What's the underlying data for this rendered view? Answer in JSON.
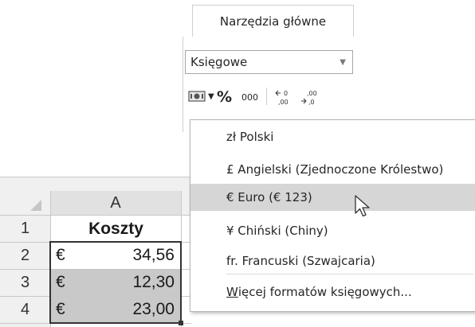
{
  "ribbon": {
    "tab_label": "Narzędzia główne",
    "number_format_value": "Księgowe",
    "percent_label": "%",
    "thousands_label": "000"
  },
  "sheet": {
    "column_header": "A",
    "rows": [
      {
        "num": "1",
        "symbol": "",
        "value": "Koszty"
      },
      {
        "num": "2",
        "symbol": "€",
        "value": "34,56"
      },
      {
        "num": "3",
        "symbol": "€",
        "value": "12,30"
      },
      {
        "num": "4",
        "symbol": "€",
        "value": "23,00"
      }
    ]
  },
  "menu": {
    "items": [
      {
        "label": "zł Polski"
      },
      {
        "label": "£ Angielski (Zjednoczone Królestwo)"
      },
      {
        "label": "€ Euro (€ 123)"
      },
      {
        "label": "¥ Chiński (Chiny)"
      },
      {
        "label": "fr. Francuski (Szwajcaria)"
      }
    ],
    "more_label_accel": "W",
    "more_label_rest": "ięcej formatów księgowych..."
  }
}
